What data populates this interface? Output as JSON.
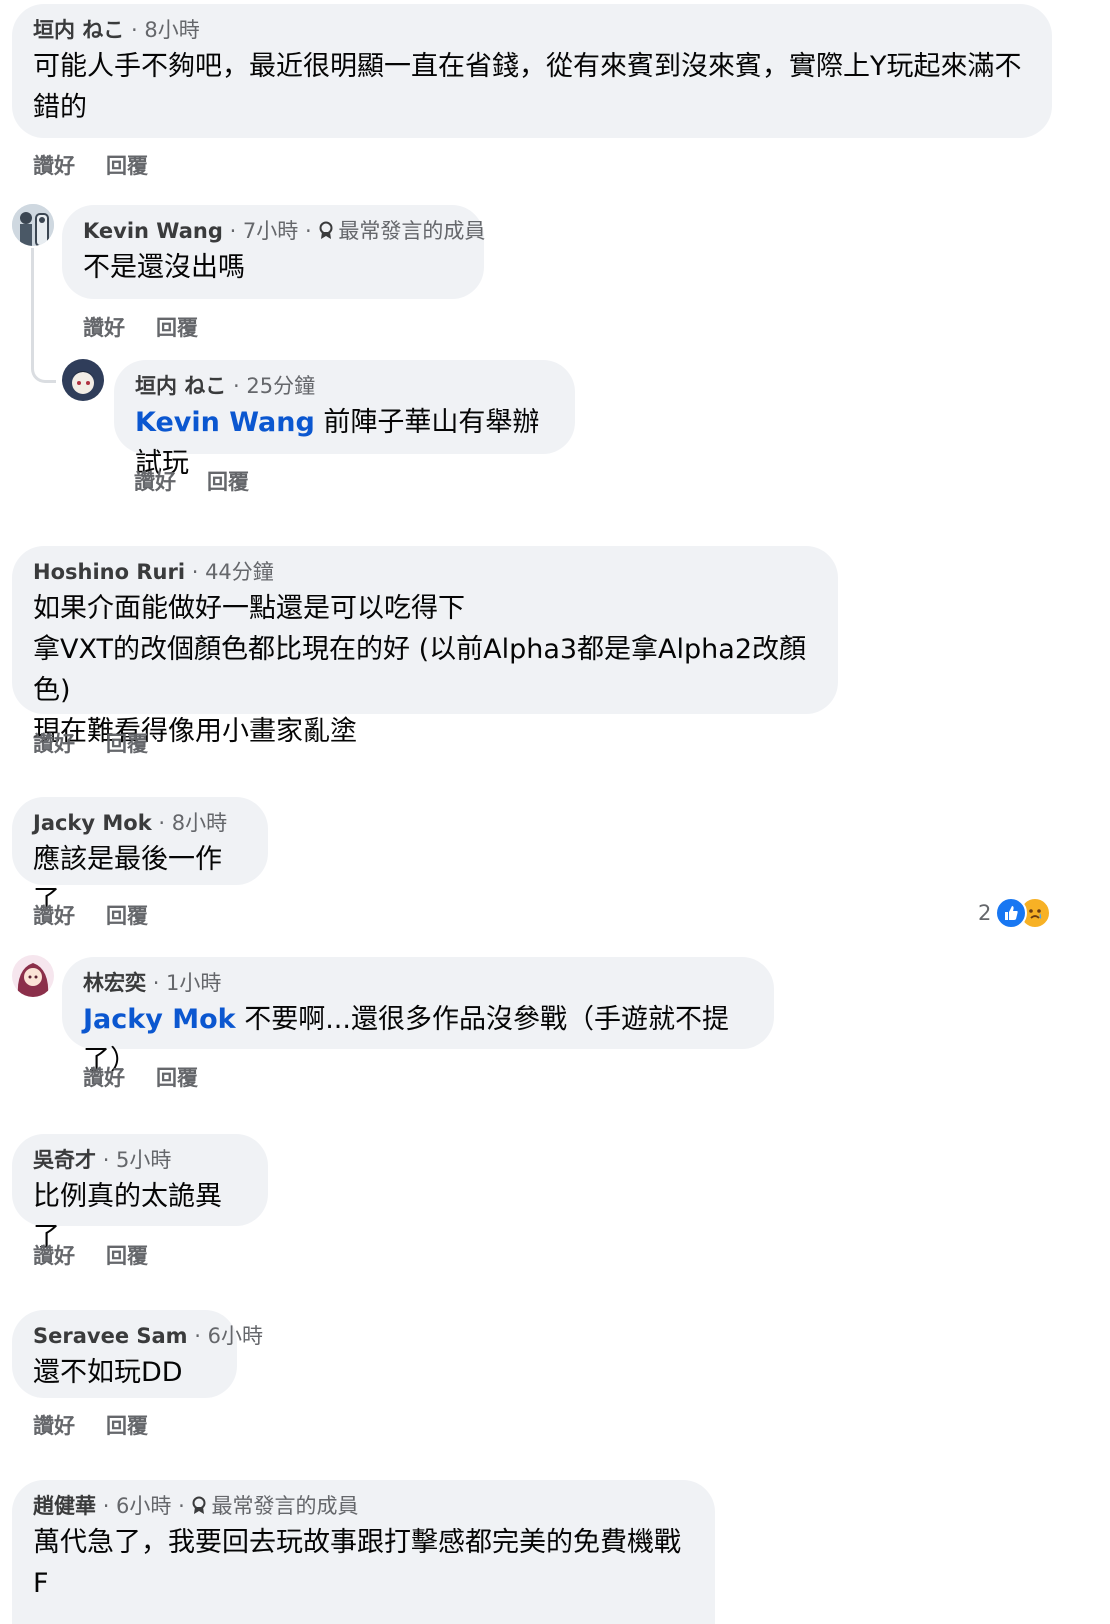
{
  "actions": {
    "like": "讚好",
    "reply": "回覆"
  },
  "badge_label": "最常發言的成員",
  "comments": [
    {
      "author": "垣内 ねこ",
      "time": "8小時",
      "lines": [
        "可能人手不夠吧，最近很明顯一直在省錢，從有來賓到沒來賓，實際上Y玩起來滿不",
        "錯的"
      ]
    },
    {
      "author": "Kevin Wang",
      "time": "7小時",
      "lines": [
        "不是還沒出嗎"
      ]
    },
    {
      "author": "垣内 ねこ",
      "time": "25分鐘",
      "mention": "Kevin Wang",
      "lines": [
        "前陣子華山有舉辦試玩"
      ]
    },
    {
      "author": "Hoshino Ruri",
      "time": "44分鐘",
      "lines": [
        "如果介面能做好一點還是可以吃得下",
        "拿VXT的改個顏色都比現在的好 (以前Alpha3都是拿Alpha2改顏色)",
        "現在難看得像用小畫家亂塗"
      ]
    },
    {
      "author": "Jacky Mok",
      "time": "8小時",
      "lines": [
        "應該是最後一作了"
      ],
      "reaction_count": "2"
    },
    {
      "author": "林宏奕",
      "time": "1小時",
      "mention": "Jacky Mok",
      "lines": [
        "不要啊...還很多作品沒參戰（手遊就不提了）"
      ]
    },
    {
      "author": "吳奇才",
      "time": "5小時",
      "lines": [
        "比例真的太詭異了"
      ]
    },
    {
      "author": "Seravee Sam",
      "time": "6小時",
      "lines": [
        "還不如玩DD"
      ]
    },
    {
      "author": "趙健華",
      "time": "6小時",
      "lines": [
        "萬代急了，我要回去玩故事跟打擊感都完美的免費機戰F"
      ]
    }
  ],
  "colors": {
    "bubble": "#f0f2f5",
    "mention": "#0b57d0",
    "like_blue": "#1877f2",
    "sad_yellow": "#f7b125"
  }
}
